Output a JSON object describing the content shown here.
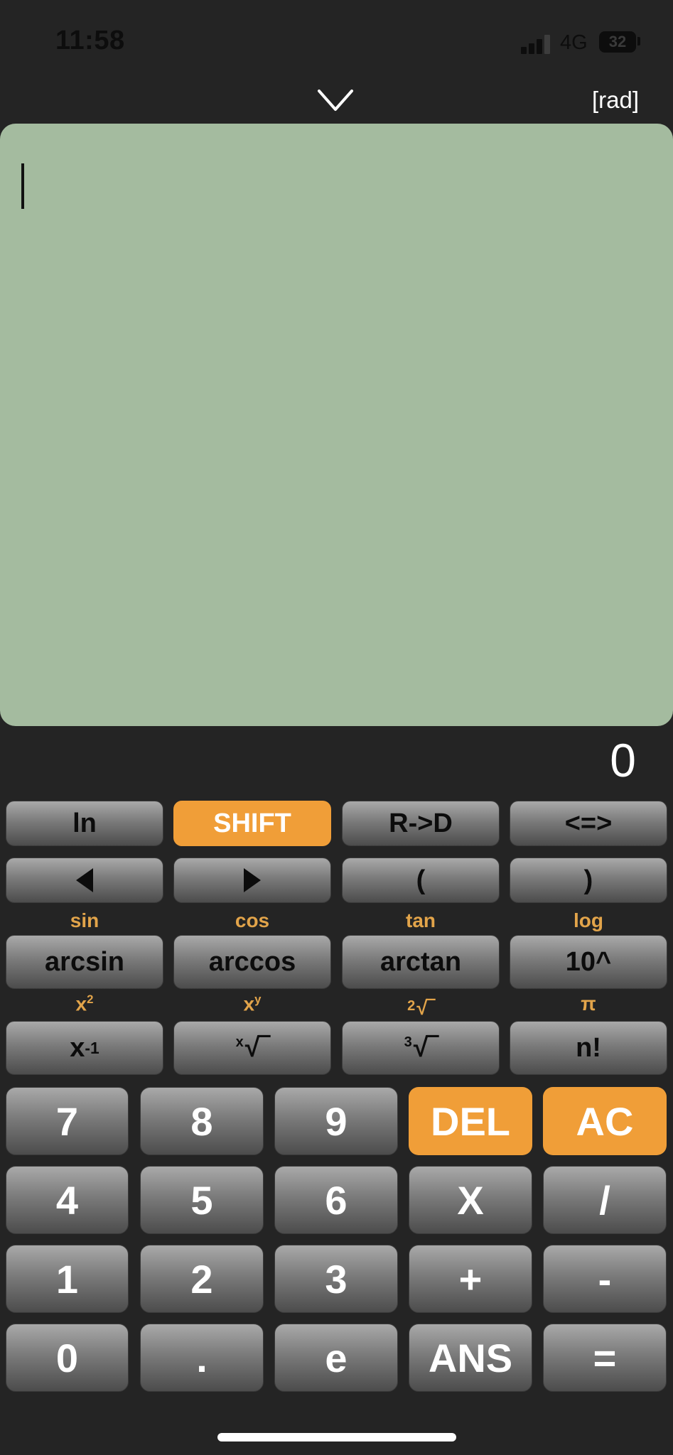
{
  "status": {
    "time": "11:58",
    "network": "4G",
    "battery": "32"
  },
  "header": {
    "collapse_icon": "chevron-down-icon",
    "angle_mode": "[rad]"
  },
  "display": {
    "expression": "",
    "result": "0"
  },
  "colors": {
    "accent": "#f09e38",
    "display_bg": "#a4bb9f",
    "shift_label": "#e2a44a",
    "background": "#242424"
  },
  "rows": {
    "row1": {
      "ln": "ln",
      "shift": "SHIFT",
      "r_to_d": "R->D",
      "swap": "<=>"
    },
    "row2": {
      "open_paren": "(",
      "close_paren": ")",
      "left_icon": "triangle-left-icon",
      "right_icon": "triangle-right-icon"
    },
    "row3_shift": {
      "sin": "sin",
      "cos": "cos",
      "tan": "tan",
      "log": "log"
    },
    "row3": {
      "arcsin": "arcsin",
      "arccos": "arccos",
      "arctan": "arctan",
      "pow10": "10^"
    },
    "row4_shift": {
      "square_base": "x",
      "square_exp": "2",
      "power_base": "x",
      "power_exp": "y",
      "sqrt_index": "2",
      "pi": "π"
    },
    "row4": {
      "inverse_base": "x",
      "inverse_exp": "-1",
      "xroot_index": "x",
      "cbrt_index": "3",
      "factorial": "n!"
    },
    "keypad": {
      "seven": "7",
      "eight": "8",
      "nine": "9",
      "del": "DEL",
      "ac": "AC",
      "four": "4",
      "five": "5",
      "six": "6",
      "multiply": "X",
      "divide": "/",
      "one": "1",
      "two": "2",
      "three": "3",
      "plus": "+",
      "minus": "-",
      "zero": "0",
      "dot": ".",
      "e": "e",
      "ans": "ANS",
      "equals": "="
    }
  }
}
